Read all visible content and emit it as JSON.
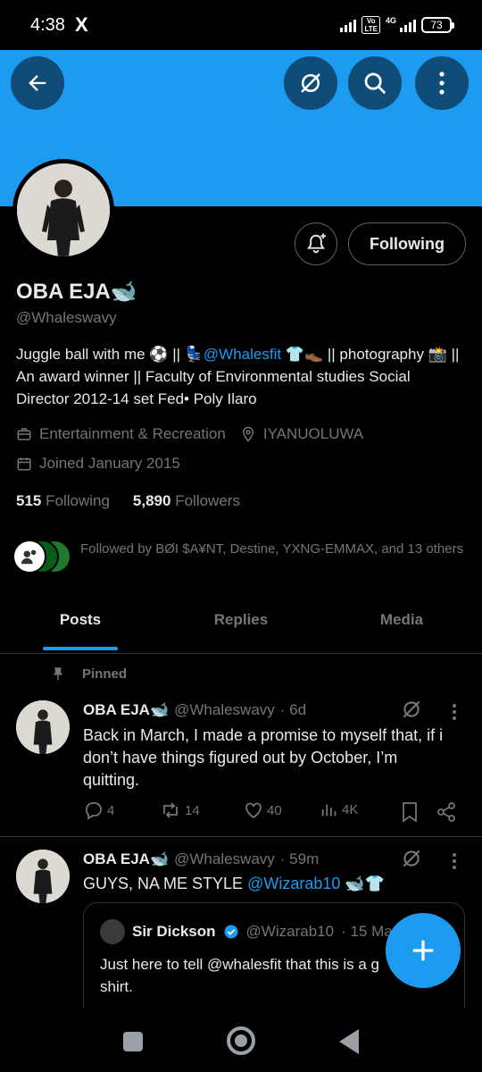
{
  "status_bar": {
    "time": "4:38",
    "app_icon": "X",
    "volte": "Vo\nLTE",
    "network": "4G",
    "battery": "73"
  },
  "header": {
    "back_icon": "arrow-left-icon",
    "grok_icon": "grok-icon",
    "search_icon": "search-icon",
    "more_icon": "more-vertical-icon",
    "banner_color": "#1d9bf0"
  },
  "profile": {
    "name": "OBA EJA🐋",
    "handle": "@Whaleswavy",
    "following_button": "Following",
    "bio_part1": "Juggle ball with me ⚽ || 💺",
    "bio_link": "@Whalesfit",
    "bio_part2": " 👕👞 || photography 📸 || An award winner || Faculty of Environmental studies Social Director 2012-14 set Fed• Poly Ilaro",
    "category": "Entertainment & Recreation",
    "location": "IYANUOLUWA",
    "joined": "Joined January 2015",
    "following_count": "515",
    "following_label": "Following",
    "followers_count": "5,890",
    "followers_label": "Followers",
    "followed_by": "Followed by BØI $A¥NT, Destine, YXNG-EMMAX, and 13 others"
  },
  "tabs": [
    {
      "label": "Posts",
      "active": true
    },
    {
      "label": "Replies",
      "active": false
    },
    {
      "label": "Media",
      "active": false
    }
  ],
  "posts": [
    {
      "pinned_label": "Pinned",
      "name": "OBA EJA🐋",
      "handle": "@Whaleswavy",
      "time": "· 6d",
      "text": "Back in March, I made a promise to myself that, if i don’t have things figured out by October, I’m quitting.",
      "replies": "4",
      "reposts": "14",
      "likes": "40",
      "views": "4K"
    },
    {
      "name": "OBA EJA🐋",
      "handle": "@Whaleswavy",
      "time": "· 59m",
      "text_part1": "GUYS, NA ME STYLE ",
      "text_link": "@Wizarab10",
      "text_part2": " 🐋👕",
      "quote": {
        "name": "Sir Dickson",
        "handle": "@Wizarab10",
        "time": "· 15 Ma",
        "text": "Just here to tell @whalesfit that this is a g shirt."
      }
    }
  ],
  "fab_icon": "plus-icon",
  "navbar": {
    "recents_icon": "square-icon",
    "home_icon": "circle-icon",
    "back_icon": "triangle-back-icon"
  }
}
